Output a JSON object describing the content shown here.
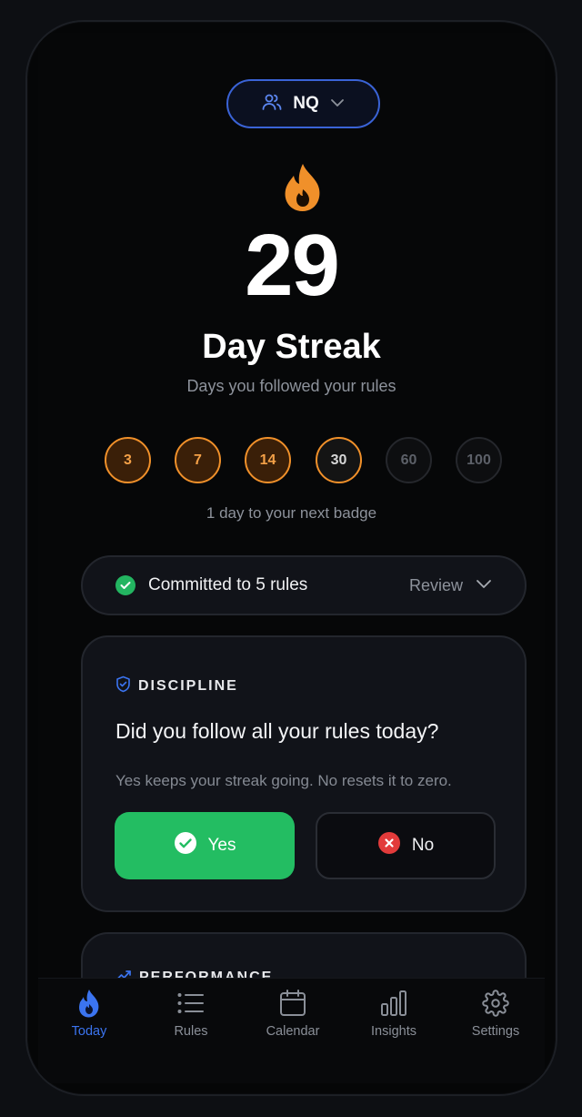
{
  "account": {
    "label": "NQ",
    "icon": "users-icon",
    "chevron": "chevron-down-icon"
  },
  "streak": {
    "icon": "flame-icon",
    "count": "29",
    "label": "Day Streak",
    "subtitle": "Days you followed your rules"
  },
  "badges": [
    {
      "value": "3",
      "state": "earned"
    },
    {
      "value": "7",
      "state": "earned"
    },
    {
      "value": "14",
      "state": "earned"
    },
    {
      "value": "30",
      "state": "next"
    },
    {
      "value": "60",
      "state": "locked"
    },
    {
      "value": "100",
      "state": "locked"
    }
  ],
  "next_badge_text": "1 day to your next badge",
  "commitment": {
    "label": "Committed to 5 rules",
    "action": "Review"
  },
  "discipline_card": {
    "tag": "DISCIPLINE",
    "question": "Did you follow all your rules today?",
    "hint": "Yes keeps your streak going. No resets it to zero.",
    "yes_label": "Yes",
    "no_label": "No"
  },
  "performance_card": {
    "tag": "PERFORMANCE"
  },
  "tabs": [
    {
      "label": "Today",
      "icon": "flame-icon",
      "active": true
    },
    {
      "label": "Rules",
      "icon": "list-icon",
      "active": false
    },
    {
      "label": "Calendar",
      "icon": "calendar-icon",
      "active": false
    },
    {
      "label": "Insights",
      "icon": "bar-chart-icon",
      "active": false
    },
    {
      "label": "Settings",
      "icon": "gear-icon",
      "active": false
    }
  ],
  "colors": {
    "accent": "#3b74f0",
    "streak_orange": "#f0902a",
    "success_green": "#23bd62",
    "danger_red": "#e23b3b"
  }
}
